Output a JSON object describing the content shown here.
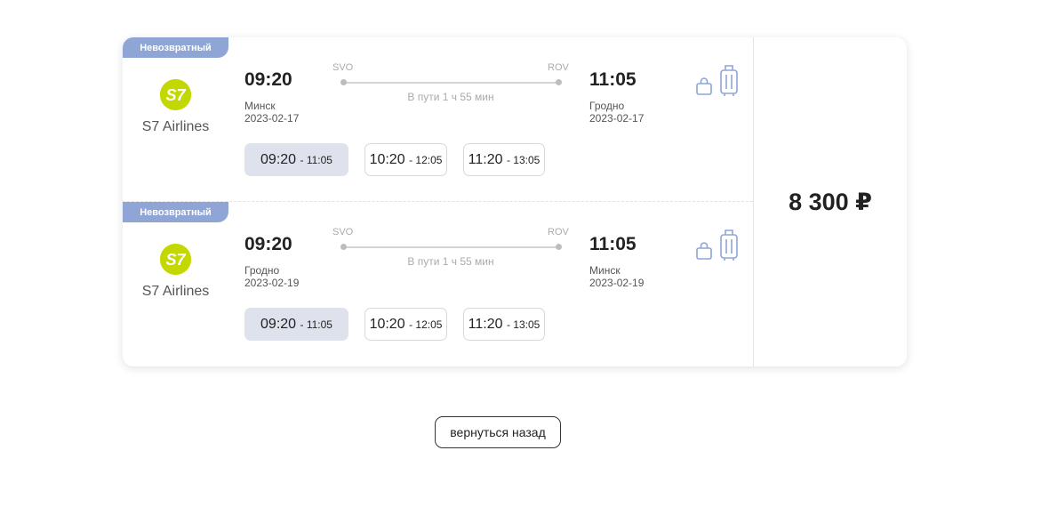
{
  "segments": [
    {
      "badge": "Невозвратный",
      "airline": {
        "name": "S7 Airlines",
        "logo_text": "S7"
      },
      "departure": {
        "time": "09:20",
        "city": "Минск",
        "date": "2023-02-17",
        "code": "SVO"
      },
      "arrival": {
        "time": "11:05",
        "city": "Гродно",
        "date": "2023-02-17",
        "code": "ROV"
      },
      "duration": "В пути 1 ч 55 мин",
      "options": [
        {
          "dep": "09:20",
          "arr": "- 11:05",
          "selected": true
        },
        {
          "dep": "10:20",
          "arr": "- 12:05",
          "selected": false
        },
        {
          "dep": "11:20",
          "arr": "- 13:05",
          "selected": false
        }
      ]
    },
    {
      "badge": "Невозвратный",
      "airline": {
        "name": "S7 Airlines",
        "logo_text": "S7"
      },
      "departure": {
        "time": "09:20",
        "city": "Гродно",
        "date": "2023-02-19",
        "code": "SVO"
      },
      "arrival": {
        "time": "11:05",
        "city": "Минск",
        "date": "2023-02-19",
        "code": "ROV"
      },
      "duration": "В пути 1 ч 55 мин",
      "options": [
        {
          "dep": "09:20",
          "arr": "- 11:05",
          "selected": true
        },
        {
          "dep": "10:20",
          "arr": "- 12:05",
          "selected": false
        },
        {
          "dep": "11:20",
          "arr": "- 13:05",
          "selected": false
        }
      ]
    }
  ],
  "price": "8 300 ₽",
  "back_button": "вернуться назад",
  "colors": {
    "badge": "#8fa5d6",
    "logo": "#c3d800",
    "selected_option": "#dde2ec",
    "icon": "#8fa5d6"
  },
  "icons": [
    "hand-bag-icon",
    "suitcase-icon"
  ]
}
